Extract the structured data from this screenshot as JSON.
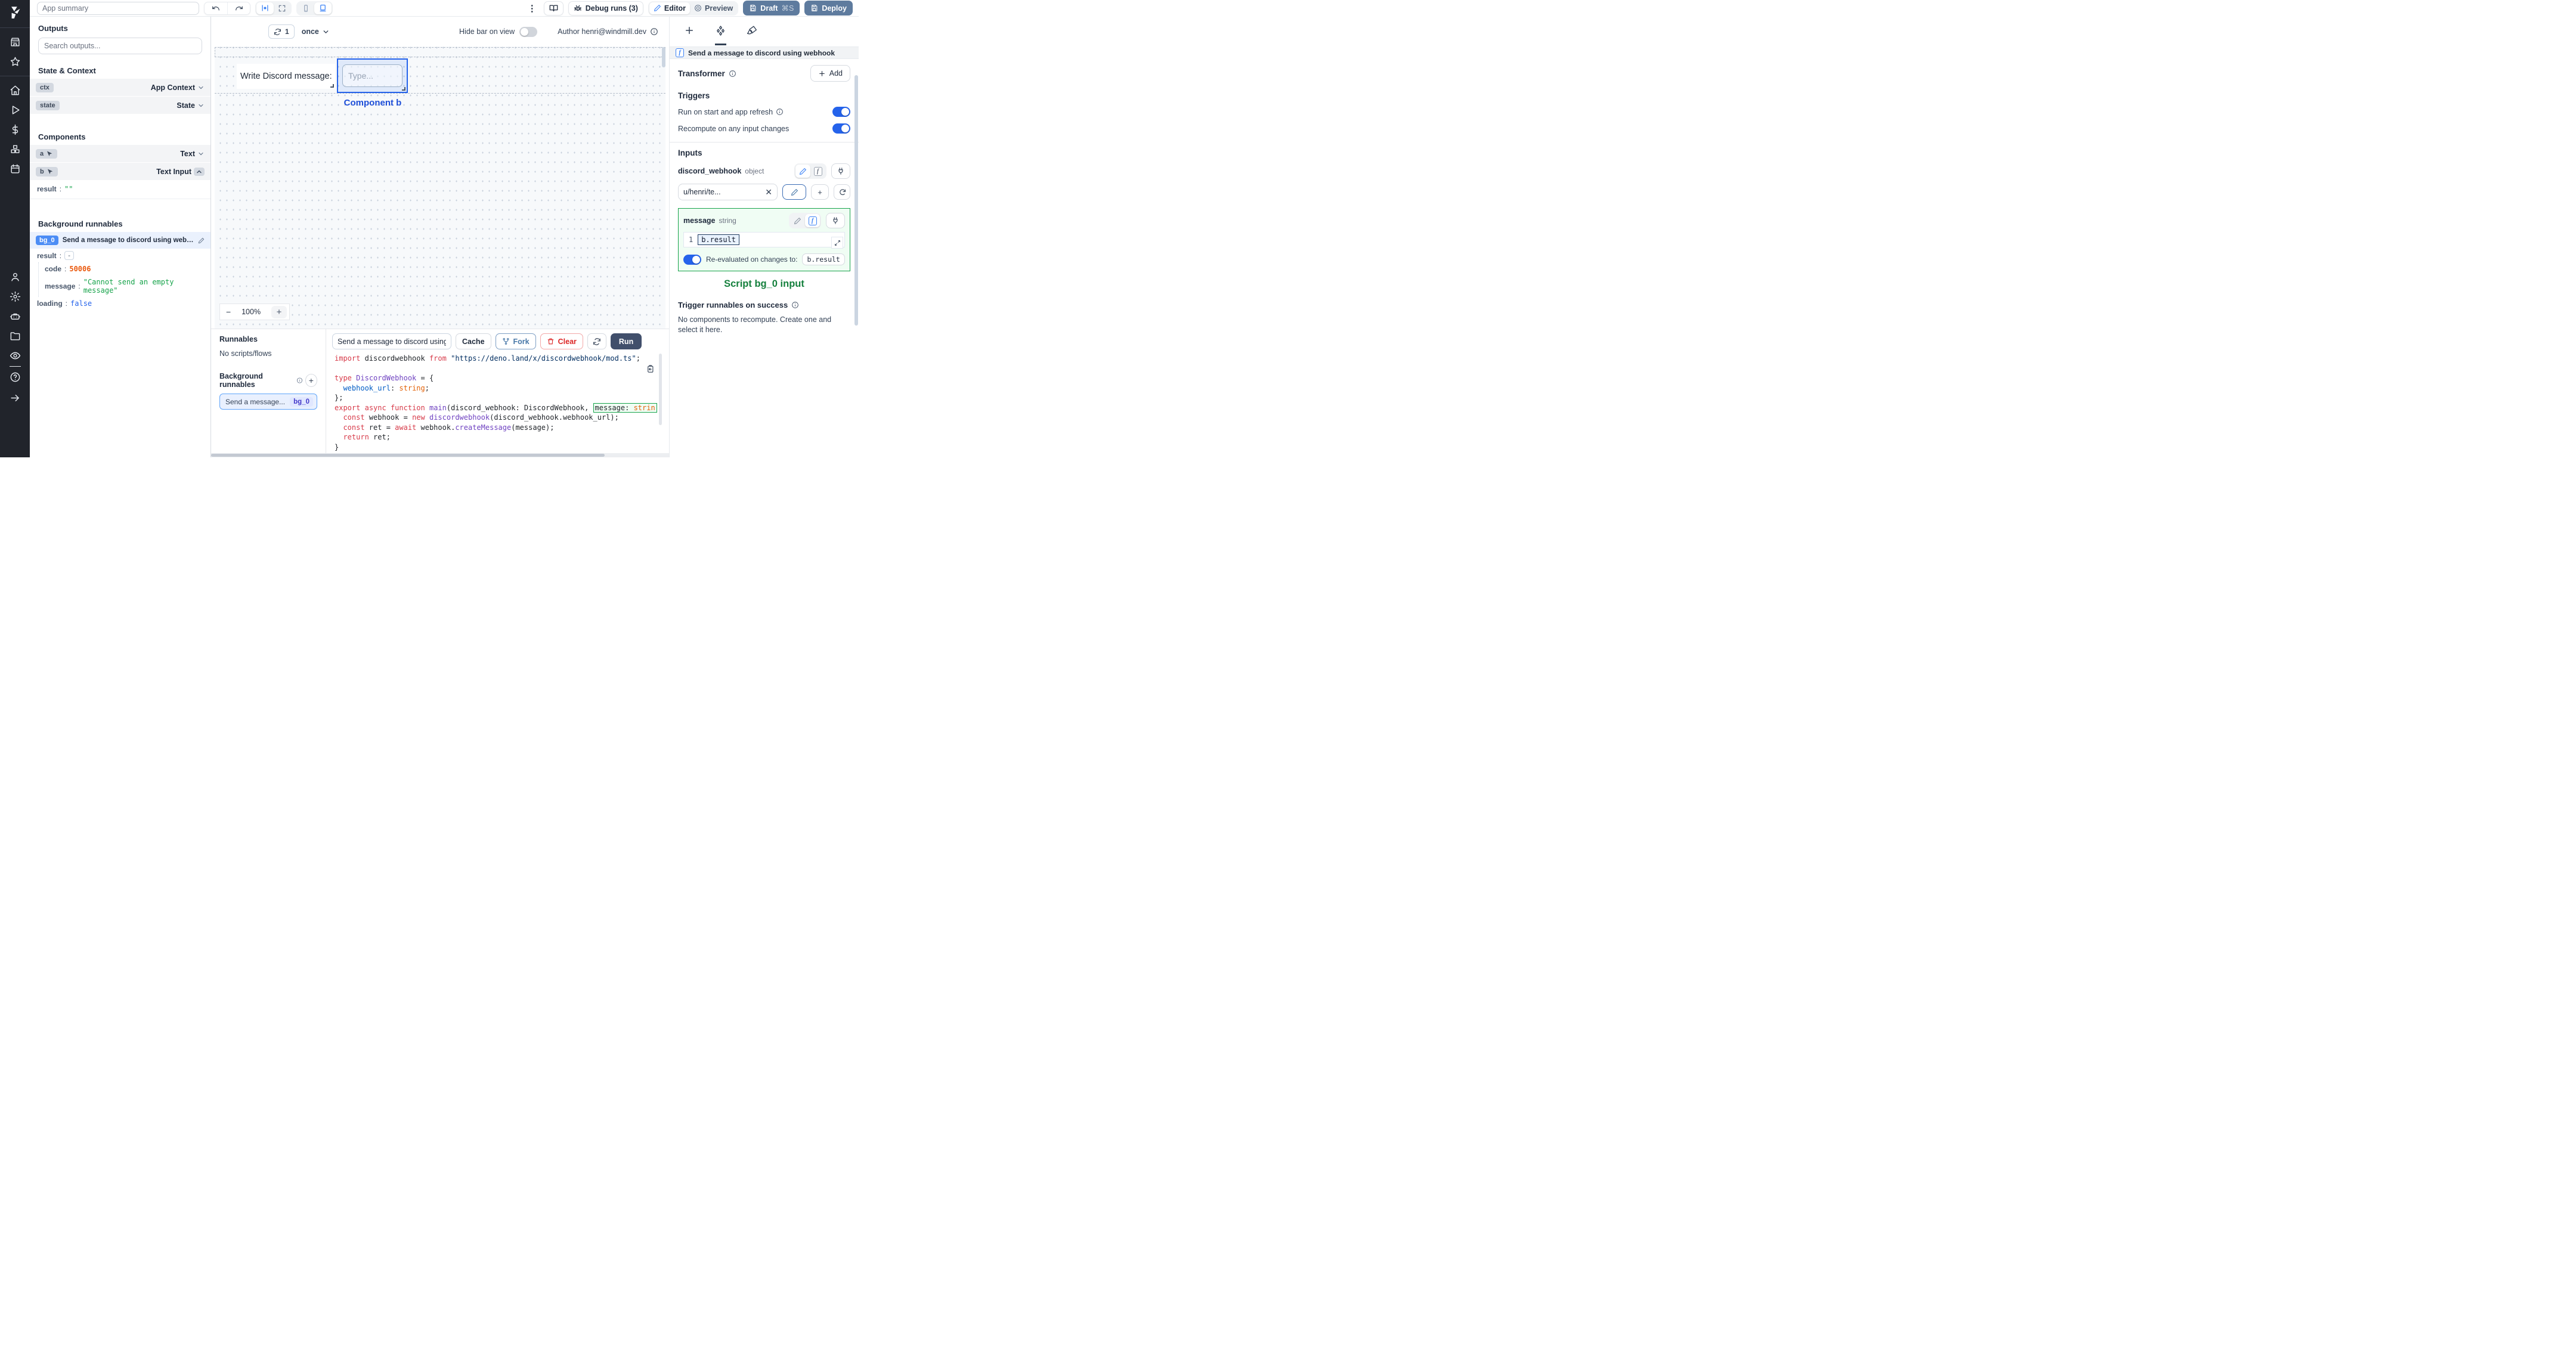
{
  "topbar": {
    "app_summary_placeholder": "App summary",
    "debug_runs_label": "Debug runs (3)",
    "editor_label": "Editor",
    "preview_label": "Preview",
    "draft_label": "Draft",
    "draft_shortcut": "⌘S",
    "deploy_label": "Deploy"
  },
  "sidebar": {
    "groups": [
      [
        "storefront",
        "star"
      ],
      [
        "home",
        "play",
        "dollar",
        "boxes",
        "calendar"
      ],
      [
        "user",
        "settings",
        "robot",
        "folder",
        "eye"
      ],
      [
        "help",
        "arrow-right"
      ]
    ]
  },
  "outputs_panel": {
    "title": "Outputs",
    "search_placeholder": "Search outputs...",
    "state_context_title": "State & Context",
    "ctx_key": "ctx",
    "ctx_type": "App Context",
    "state_key": "state",
    "state_type": "State",
    "components_title": "Components",
    "comp_a_key": "a",
    "comp_a_type": "Text",
    "comp_b_key": "b",
    "comp_b_type": "Text Input",
    "comp_b_result_key": "result",
    "comp_b_result_value": "\"\"",
    "bg_title": "Background runnables",
    "bg0_badge": "bg_0",
    "bg0_name": "Send a message to discord using webhook",
    "bg0_result_key": "result",
    "bg0_collapse": "-",
    "bg0_code_key": "code",
    "bg0_code_value": "50006",
    "bg0_message_key": "message",
    "bg0_message_value": "\"Cannot send an empty message\"",
    "bg0_loading_key": "loading",
    "bg0_loading_value": "false"
  },
  "canvas": {
    "refresh_count": "1",
    "interval": "once",
    "hide_bar_label": "Hide bar on view",
    "author": "Author henri@windmill.dev",
    "text_component": "Write Discord message:",
    "input_placeholder": "Type...",
    "selected_label": "Component b",
    "zoom_minus": "−",
    "zoom_level": "100%",
    "zoom_plus": "+"
  },
  "runnables_panel": {
    "title": "Runnables",
    "empty": "No scripts/flows",
    "bg_title": "Background runnables",
    "item_name": "Send a message...",
    "item_badge": "bg_0"
  },
  "editor_panel": {
    "script_name": "Send a message to discord using",
    "cache_label": "Cache",
    "fork_label": "Fork",
    "clear_label": "Clear",
    "run_label": "Run",
    "code_lines": [
      {
        "tokens": [
          {
            "c": "kw",
            "v": "import"
          },
          {
            "c": "pl",
            "v": " discordwebhook "
          },
          {
            "c": "kw",
            "v": "from"
          },
          {
            "c": "pl",
            "v": " "
          },
          {
            "c": "str",
            "v": "\"https://deno.land/x/discordwebhook/mod.ts\""
          },
          {
            "c": "pl",
            "v": ";"
          }
        ]
      },
      {
        "tokens": []
      },
      {
        "tokens": [
          {
            "c": "kw",
            "v": "type"
          },
          {
            "c": "pl",
            "v": " "
          },
          {
            "c": "ty",
            "v": "DiscordWebhook"
          },
          {
            "c": "pl",
            "v": " = {"
          }
        ]
      },
      {
        "tokens": [
          {
            "c": "pl",
            "v": "  "
          },
          {
            "c": "pr",
            "v": "webhook_url"
          },
          {
            "c": "pl",
            "v": ": "
          },
          {
            "c": "or",
            "v": "string"
          },
          {
            "c": "pl",
            "v": ";"
          }
        ]
      },
      {
        "tokens": [
          {
            "c": "pl",
            "v": "};"
          }
        ]
      },
      {
        "tokens": [
          {
            "c": "kw",
            "v": "export"
          },
          {
            "c": "pl",
            "v": " "
          },
          {
            "c": "kw",
            "v": "async"
          },
          {
            "c": "pl",
            "v": " "
          },
          {
            "c": "kw",
            "v": "function"
          },
          {
            "c": "pl",
            "v": " "
          },
          {
            "c": "ty",
            "v": "main"
          },
          {
            "c": "pl",
            "v": "(discord_webhook: DiscordWebhook, "
          },
          {
            "hl": [
              {
                "c": "pl",
                "v": "message: "
              },
              {
                "c": "or",
                "v": "strin"
              }
            ]
          }
        ]
      },
      {
        "tokens": [
          {
            "c": "pl",
            "v": "  "
          },
          {
            "c": "kw",
            "v": "const"
          },
          {
            "c": "pl",
            "v": " webhook = "
          },
          {
            "c": "kw",
            "v": "new"
          },
          {
            "c": "pl",
            "v": " "
          },
          {
            "c": "ty",
            "v": "discordwebhook"
          },
          {
            "c": "pl",
            "v": "(discord_webhook.webhook_url);"
          }
        ]
      },
      {
        "tokens": [
          {
            "c": "pl",
            "v": "  "
          },
          {
            "c": "kw",
            "v": "const"
          },
          {
            "c": "pl",
            "v": " ret = "
          },
          {
            "c": "kw",
            "v": "await"
          },
          {
            "c": "pl",
            "v": " webhook."
          },
          {
            "c": "ty",
            "v": "createMessage"
          },
          {
            "c": "pl",
            "v": "(message);"
          }
        ]
      },
      {
        "tokens": [
          {
            "c": "pl",
            "v": "  "
          },
          {
            "c": "kw",
            "v": "return"
          },
          {
            "c": "pl",
            "v": " ret;"
          }
        ]
      },
      {
        "tokens": [
          {
            "c": "pl",
            "v": "}"
          }
        ]
      }
    ]
  },
  "settings_panel": {
    "header_title": "Send a message to discord using webhook",
    "transformer_title": "Transformer",
    "add_label": "Add",
    "triggers_title": "Triggers",
    "run_on_start_label": "Run on start and app refresh",
    "recompute_label": "Recompute on any input changes",
    "inputs_title": "Inputs",
    "discord_webhook_name": "discord_webhook",
    "discord_webhook_type": "object",
    "discord_webhook_value": "u/henri/te...",
    "message_name": "message",
    "message_type": "string",
    "message_line_no": "1",
    "message_expr": "b.result",
    "reeval_label": "Re-evaluated on changes to:",
    "reeval_target": "b.result",
    "caption": "Script bg_0 input",
    "trigger_success_title": "Trigger runnables on success",
    "no_components_text": "No components to recompute. Create one and select it here."
  },
  "colors": {
    "accent_blue": "#2563eb",
    "selection_blue": "#3b82f6",
    "success_green": "#16a34a",
    "error_red": "#dc2626",
    "code_orange": "#ea580c",
    "draft_button": "#5e7b9e",
    "run_button": "#414f6b",
    "rail_background": "#21242b"
  }
}
